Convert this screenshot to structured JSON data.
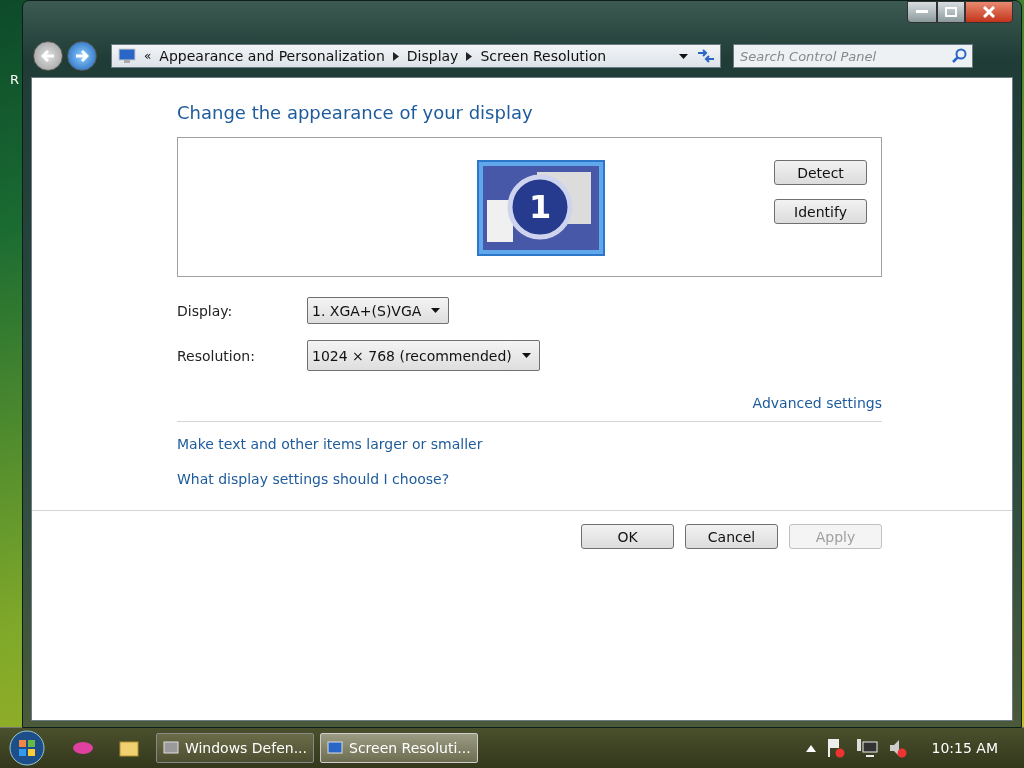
{
  "desktop": {
    "icon_label": "R"
  },
  "window": {
    "nav": {
      "back_disabled": true,
      "forward_disabled": false
    },
    "address_bar": {
      "overflow": "«",
      "crumbs": [
        "Appearance and Personalization",
        "Display",
        "Screen Resolution"
      ]
    },
    "search": {
      "placeholder": "Search Control Panel"
    },
    "heading": "Change the appearance of your display",
    "monitors": [
      {
        "number": "1",
        "selected": true
      }
    ],
    "side_buttons": [
      "Detect",
      "Identify"
    ],
    "fields": [
      {
        "label": "Display:",
        "value": "1. XGA+(S)VGA"
      },
      {
        "label": "Resolution:",
        "value": "1024 × 768 (recommended)"
      }
    ],
    "advanced_link": "Advanced settings",
    "links": [
      "Make text and other items larger or smaller",
      "What display settings should I choose?"
    ],
    "dialog_buttons": [
      {
        "label": "OK",
        "disabled": false
      },
      {
        "label": "Cancel",
        "disabled": false
      },
      {
        "label": "Apply",
        "disabled": true
      }
    ]
  },
  "taskbar": {
    "items": [
      {
        "label": "Windows Defen...",
        "selected": false
      },
      {
        "label": "Screen Resoluti...",
        "selected": true
      }
    ],
    "clock": "10:15 AM"
  }
}
